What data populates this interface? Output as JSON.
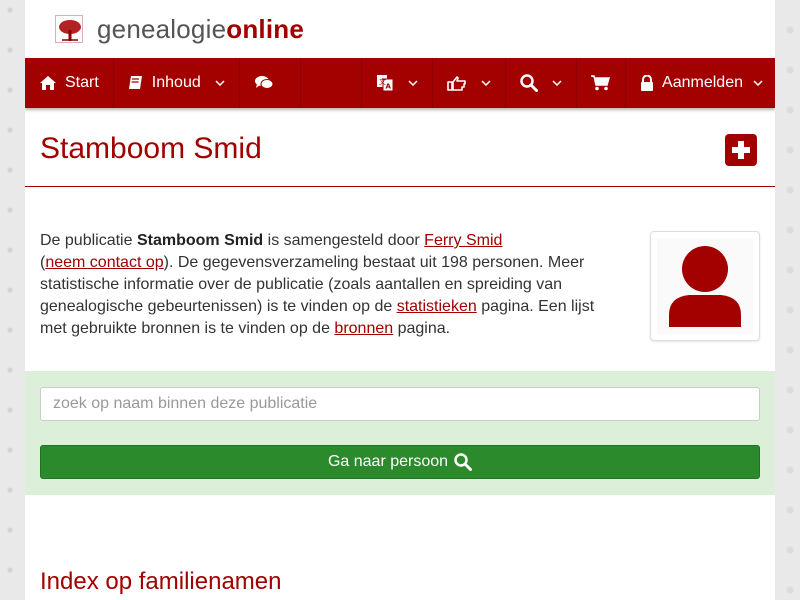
{
  "brand": {
    "part1": "genealogie",
    "part2": "online",
    "logo_icon": "tree-logo-icon"
  },
  "nav": {
    "start": "Start",
    "inhoud": "Inhoud",
    "aanmelden": "Aanmelden"
  },
  "page": {
    "title": "Stamboom Smid"
  },
  "intro": {
    "t1": "De publicatie ",
    "pub": "Stamboom Smid",
    "t2": " is samengesteld door ",
    "author": "Ferry Smid",
    "t3": "(",
    "contact": "neem contact op",
    "t4": "). De gegevensverzameling bestaat uit 198 personen. Meer statistische informatie over de publicatie (zoals aantallen en spreiding van genealogische gebeurtenissen) is te vinden op de ",
    "stats": "statistieken",
    "t5": " pagina. Een lijst met gebruikte bronnen is te vinden op de ",
    "sources": "bronnen",
    "t6": " pagina."
  },
  "search": {
    "placeholder": "zoek op naam binnen deze publicatie",
    "button": "Ga naar persoon"
  },
  "sections": {
    "index_title": "Index op familienamen"
  },
  "colors": {
    "brand": "#a30000",
    "go": "#2b8a2b",
    "band": "#dcefd8"
  }
}
